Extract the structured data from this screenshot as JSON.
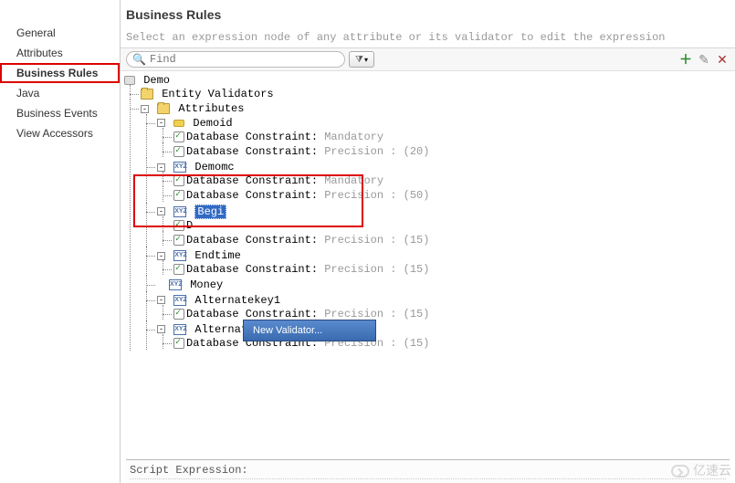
{
  "sidebar": {
    "items": [
      {
        "label": "General"
      },
      {
        "label": "Attributes"
      },
      {
        "label": "Business Rules"
      },
      {
        "label": "Java"
      },
      {
        "label": "Business Events"
      },
      {
        "label": "View Accessors"
      }
    ]
  },
  "header": {
    "title": "Business Rules",
    "subtitle": "Select an expression node of any attribute or its validator to edit the expression"
  },
  "toolbar": {
    "search_placeholder": "Find",
    "filter_label": "▼",
    "add_tip": "+",
    "edit_tip": "✎",
    "delete_tip": "✕"
  },
  "tree": {
    "root": "Demo",
    "entity_validators": "Entity Validators",
    "attributes": "Attributes",
    "attrs": [
      {
        "name": "Demoid",
        "icon": "key",
        "constraints": [
          {
            "label": "Database Constraint:",
            "value": "Mandatory"
          },
          {
            "label": "Database Constraint:",
            "value": "Precision : (20)"
          }
        ]
      },
      {
        "name": "Demomc",
        "icon": "xyz",
        "constraints": [
          {
            "label": "Database Constraint:",
            "value": "Mandatory"
          },
          {
            "label": "Database Constraint:",
            "value": "Precision : (50)"
          }
        ]
      },
      {
        "name": "Begi",
        "icon": "xyz",
        "selected": true,
        "constraints": [
          {
            "label": "D",
            "value": ""
          },
          {
            "label": "Database Constraint:",
            "value": "Precision : (15)"
          }
        ]
      },
      {
        "name": "Endtime",
        "icon": "xyz",
        "constraints": [
          {
            "label": "Database Constraint:",
            "value": "Precision : (15)"
          }
        ]
      },
      {
        "name": "Money",
        "icon": "xyz",
        "leaf": true,
        "constraints": []
      },
      {
        "name": "Alternatekey1",
        "icon": "xyz",
        "constraints": [
          {
            "label": "Database Constraint:",
            "value": "Precision : (15)"
          }
        ]
      },
      {
        "name": "Alternatekey2",
        "icon": "xyz",
        "constraints": [
          {
            "label": "Database Constraint:",
            "value": "Precision : (15)"
          }
        ]
      }
    ]
  },
  "context_menu": {
    "new_validator": "New Validator..."
  },
  "bottom": {
    "title": "Script Expression:"
  },
  "watermark": "亿速云",
  "exp": {
    "minus": "-",
    "plus": "+"
  }
}
